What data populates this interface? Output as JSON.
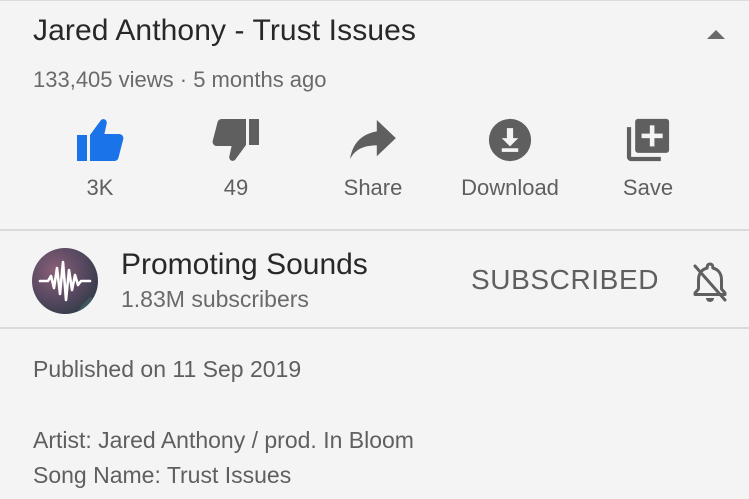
{
  "video": {
    "title": "Jared Anthony - Trust Issues",
    "meta": "133,405 views · 5 months ago"
  },
  "actions": [
    {
      "label": "3K",
      "icon": "thumbs-up-icon"
    },
    {
      "label": "49",
      "icon": "thumbs-down-icon"
    },
    {
      "label": "Share",
      "icon": "share-icon"
    },
    {
      "label": "Download",
      "icon": "download-icon"
    },
    {
      "label": "Save",
      "icon": "playlist-add-icon"
    }
  ],
  "channel": {
    "name": "Promoting Sounds",
    "subscribers": "1.83M subscribers",
    "subscribe_label": "SUBSCRIBED"
  },
  "description": {
    "published": "Published on 11 Sep 2019",
    "lines": [
      "Artist: Jared Anthony / prod. In Bloom",
      "Song Name: Trust Issues"
    ]
  },
  "colors": {
    "accent": "#1a73e8",
    "icon_gray": "#5f5f5f",
    "text_primary": "#282828",
    "text_secondary": "#6a6a6a",
    "background": "#f4f4f4"
  }
}
